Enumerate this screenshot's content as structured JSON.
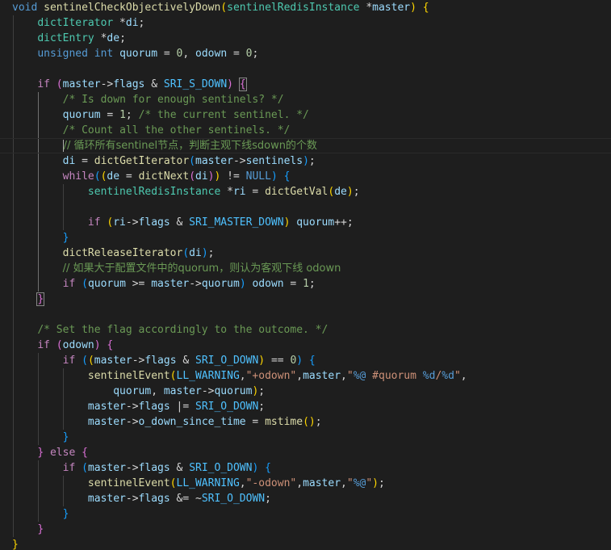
{
  "editor": {
    "theme_colors": {
      "background": "#1e1e1e",
      "default": "#d4d4d4",
      "keyword": "#569cd6",
      "control": "#c586c0",
      "function": "#dcdcaa",
      "type": "#4ec9b0",
      "variable": "#9cdcfe",
      "constant": "#4fc1ff",
      "number": "#b5cea8",
      "string": "#ce9178",
      "comment": "#6a9955",
      "bracket_gold": "#ffd700",
      "bracket_pink": "#da70d6",
      "bracket_blue": "#179fff"
    },
    "lines": [
      [
        [
          "void",
          "keyword"
        ],
        [
          " ",
          ""
        ],
        [
          "sentinelCheckObjectivelyDown",
          "function"
        ],
        [
          "(",
          "bracket_gold"
        ],
        [
          "sentinelRedisInstance",
          "type"
        ],
        [
          " *",
          ""
        ],
        [
          "master",
          "variable"
        ],
        [
          ")",
          "bracket_gold"
        ],
        [
          " ",
          ""
        ],
        [
          "{",
          "bracket_gold"
        ]
      ],
      [
        [
          "    ",
          ""
        ],
        [
          "dictIterator",
          "type"
        ],
        [
          " *",
          ""
        ],
        [
          "di",
          "variable"
        ],
        [
          ";",
          ""
        ]
      ],
      [
        [
          "    ",
          ""
        ],
        [
          "dictEntry",
          "type"
        ],
        [
          " *",
          ""
        ],
        [
          "de",
          "variable"
        ],
        [
          ";",
          ""
        ]
      ],
      [
        [
          "    ",
          ""
        ],
        [
          "unsigned",
          "keyword"
        ],
        [
          " ",
          ""
        ],
        [
          "int",
          "keyword"
        ],
        [
          " ",
          ""
        ],
        [
          "quorum",
          "variable"
        ],
        [
          " = ",
          ""
        ],
        [
          "0",
          "number"
        ],
        [
          ", ",
          ""
        ],
        [
          "odown",
          "variable"
        ],
        [
          " = ",
          ""
        ],
        [
          "0",
          "number"
        ],
        [
          ";",
          ""
        ]
      ],
      [],
      [
        [
          "    ",
          ""
        ],
        [
          "if",
          "control"
        ],
        [
          " ",
          ""
        ],
        [
          "(",
          "bracket_pink"
        ],
        [
          "master",
          "variable"
        ],
        [
          "->",
          ""
        ],
        [
          "flags",
          "variable"
        ],
        [
          " & ",
          ""
        ],
        [
          "SRI_S_DOWN",
          "constant"
        ],
        [
          ")",
          "bracket_pink"
        ],
        [
          " ",
          ""
        ],
        [
          "{",
          "bracket_pink_box"
        ]
      ],
      [
        [
          "        ",
          ""
        ],
        [
          "/* Is down for enough sentinels? */",
          "comment"
        ]
      ],
      [
        [
          "        ",
          ""
        ],
        [
          "quorum",
          "variable"
        ],
        [
          " = ",
          ""
        ],
        [
          "1",
          "number"
        ],
        [
          "; ",
          ""
        ],
        [
          "/* the current sentinel. */",
          "comment"
        ]
      ],
      [
        [
          "        ",
          ""
        ],
        [
          "/* Count all the other sentinels. */",
          "comment"
        ]
      ],
      [
        [
          "        ",
          ""
        ],
        [
          "caret",
          ""
        ],
        [
          "// 循环所有sentinel节点，判断主观下线sdown的个数",
          "comment"
        ]
      ],
      [
        [
          "        ",
          ""
        ],
        [
          "di",
          "variable"
        ],
        [
          " = ",
          ""
        ],
        [
          "dictGetIterator",
          "function"
        ],
        [
          "(",
          "bracket_blue"
        ],
        [
          "master",
          "variable"
        ],
        [
          "->",
          ""
        ],
        [
          "sentinels",
          "variable"
        ],
        [
          ")",
          "bracket_blue"
        ],
        [
          ";",
          ""
        ]
      ],
      [
        [
          "        ",
          ""
        ],
        [
          "while",
          "control"
        ],
        [
          "(",
          "bracket_blue"
        ],
        [
          "(",
          "bracket_gold"
        ],
        [
          "de",
          "variable"
        ],
        [
          " = ",
          ""
        ],
        [
          "dictNext",
          "function"
        ],
        [
          "(",
          "bracket_pink"
        ],
        [
          "di",
          "variable"
        ],
        [
          ")",
          "bracket_pink"
        ],
        [
          ")",
          "bracket_gold"
        ],
        [
          " != ",
          ""
        ],
        [
          "NULL",
          "keyword"
        ],
        [
          ")",
          "bracket_blue"
        ],
        [
          " ",
          ""
        ],
        [
          "{",
          "bracket_blue"
        ]
      ],
      [
        [
          "            ",
          ""
        ],
        [
          "sentinelRedisInstance",
          "type"
        ],
        [
          " *",
          ""
        ],
        [
          "ri",
          "variable"
        ],
        [
          " = ",
          ""
        ],
        [
          "dictGetVal",
          "function"
        ],
        [
          "(",
          "bracket_gold"
        ],
        [
          "de",
          "variable"
        ],
        [
          ")",
          "bracket_gold"
        ],
        [
          ";",
          ""
        ]
      ],
      [],
      [
        [
          "            ",
          ""
        ],
        [
          "if",
          "control"
        ],
        [
          " ",
          ""
        ],
        [
          "(",
          "bracket_gold"
        ],
        [
          "ri",
          "variable"
        ],
        [
          "->",
          ""
        ],
        [
          "flags",
          "variable"
        ],
        [
          " & ",
          ""
        ],
        [
          "SRI_MASTER_DOWN",
          "constant"
        ],
        [
          ")",
          "bracket_gold"
        ],
        [
          " ",
          ""
        ],
        [
          "quorum",
          "variable"
        ],
        [
          "++;",
          ""
        ]
      ],
      [
        [
          "        ",
          ""
        ],
        [
          "}",
          "bracket_blue"
        ]
      ],
      [
        [
          "        ",
          ""
        ],
        [
          "dictReleaseIterator",
          "function"
        ],
        [
          "(",
          "bracket_blue"
        ],
        [
          "di",
          "variable"
        ],
        [
          ")",
          "bracket_blue"
        ],
        [
          ";",
          ""
        ]
      ],
      [
        [
          "        ",
          ""
        ],
        [
          "// 如果大于配置文件中的quorum，则认为客观下线 odown",
          "comment"
        ]
      ],
      [
        [
          "        ",
          ""
        ],
        [
          "if",
          "control"
        ],
        [
          " ",
          ""
        ],
        [
          "(",
          "bracket_blue"
        ],
        [
          "quorum",
          "variable"
        ],
        [
          " >= ",
          ""
        ],
        [
          "master",
          "variable"
        ],
        [
          "->",
          ""
        ],
        [
          "quorum",
          "variable"
        ],
        [
          ")",
          "bracket_blue"
        ],
        [
          " ",
          ""
        ],
        [
          "odown",
          "variable"
        ],
        [
          " = ",
          ""
        ],
        [
          "1",
          "number"
        ],
        [
          ";",
          ""
        ]
      ],
      [
        [
          "    ",
          ""
        ],
        [
          "}",
          "bracket_pink_box"
        ]
      ],
      [],
      [
        [
          "    ",
          ""
        ],
        [
          "/* Set the flag accordingly to the outcome. */",
          "comment"
        ]
      ],
      [
        [
          "    ",
          ""
        ],
        [
          "if",
          "control"
        ],
        [
          " ",
          ""
        ],
        [
          "(",
          "bracket_pink"
        ],
        [
          "odown",
          "variable"
        ],
        [
          ")",
          "bracket_pink"
        ],
        [
          " ",
          ""
        ],
        [
          "{",
          "bracket_pink"
        ]
      ],
      [
        [
          "        ",
          ""
        ],
        [
          "if",
          "control"
        ],
        [
          " ",
          ""
        ],
        [
          "(",
          "bracket_blue"
        ],
        [
          "(",
          "bracket_gold"
        ],
        [
          "master",
          "variable"
        ],
        [
          "->",
          ""
        ],
        [
          "flags",
          "variable"
        ],
        [
          " & ",
          ""
        ],
        [
          "SRI_O_DOWN",
          "constant"
        ],
        [
          ")",
          "bracket_gold"
        ],
        [
          " == ",
          ""
        ],
        [
          "0",
          "number"
        ],
        [
          ")",
          "bracket_blue"
        ],
        [
          " ",
          ""
        ],
        [
          "{",
          "bracket_blue"
        ]
      ],
      [
        [
          "            ",
          ""
        ],
        [
          "sentinelEvent",
          "function"
        ],
        [
          "(",
          "bracket_gold"
        ],
        [
          "LL_WARNING",
          "constant"
        ],
        [
          ",",
          ""
        ],
        [
          "\"+odown\"",
          "string"
        ],
        [
          ",",
          ""
        ],
        [
          "master",
          "variable"
        ],
        [
          ",",
          ""
        ],
        [
          "\"",
          "string"
        ],
        [
          "%@",
          "keyword"
        ],
        [
          " #quorum ",
          "string"
        ],
        [
          "%d",
          "keyword"
        ],
        [
          "/",
          "string"
        ],
        [
          "%d",
          "keyword"
        ],
        [
          "\"",
          "string"
        ],
        [
          ",",
          ""
        ]
      ],
      [
        [
          "                ",
          ""
        ],
        [
          "quorum",
          "variable"
        ],
        [
          ", ",
          ""
        ],
        [
          "master",
          "variable"
        ],
        [
          "->",
          ""
        ],
        [
          "quorum",
          "variable"
        ],
        [
          ")",
          "bracket_gold"
        ],
        [
          ";",
          ""
        ]
      ],
      [
        [
          "            ",
          ""
        ],
        [
          "master",
          "variable"
        ],
        [
          "->",
          ""
        ],
        [
          "flags",
          "variable"
        ],
        [
          " |= ",
          ""
        ],
        [
          "SRI_O_DOWN",
          "constant"
        ],
        [
          ";",
          ""
        ]
      ],
      [
        [
          "            ",
          ""
        ],
        [
          "master",
          "variable"
        ],
        [
          "->",
          ""
        ],
        [
          "o_down_since_time",
          "variable"
        ],
        [
          " = ",
          ""
        ],
        [
          "mstime",
          "function"
        ],
        [
          "(",
          "bracket_gold"
        ],
        [
          ")",
          "bracket_gold"
        ],
        [
          ";",
          ""
        ]
      ],
      [
        [
          "        ",
          ""
        ],
        [
          "}",
          "bracket_blue"
        ]
      ],
      [
        [
          "    ",
          ""
        ],
        [
          "}",
          "bracket_pink"
        ],
        [
          " ",
          ""
        ],
        [
          "else",
          "control"
        ],
        [
          " ",
          ""
        ],
        [
          "{",
          "bracket_pink"
        ]
      ],
      [
        [
          "        ",
          ""
        ],
        [
          "if",
          "control"
        ],
        [
          " ",
          ""
        ],
        [
          "(",
          "bracket_blue"
        ],
        [
          "master",
          "variable"
        ],
        [
          "->",
          ""
        ],
        [
          "flags",
          "variable"
        ],
        [
          " & ",
          ""
        ],
        [
          "SRI_O_DOWN",
          "constant"
        ],
        [
          ")",
          "bracket_blue"
        ],
        [
          " ",
          ""
        ],
        [
          "{",
          "bracket_blue"
        ]
      ],
      [
        [
          "            ",
          ""
        ],
        [
          "sentinelEvent",
          "function"
        ],
        [
          "(",
          "bracket_gold"
        ],
        [
          "LL_WARNING",
          "constant"
        ],
        [
          ",",
          ""
        ],
        [
          "\"-odown\"",
          "string"
        ],
        [
          ",",
          ""
        ],
        [
          "master",
          "variable"
        ],
        [
          ",",
          ""
        ],
        [
          "\"",
          "string"
        ],
        [
          "%@",
          "keyword"
        ],
        [
          "\"",
          "string"
        ],
        [
          ")",
          "bracket_gold"
        ],
        [
          ";",
          ""
        ]
      ],
      [
        [
          "            ",
          ""
        ],
        [
          "master",
          "variable"
        ],
        [
          "->",
          ""
        ],
        [
          "flags",
          "variable"
        ],
        [
          " &= ~",
          ""
        ],
        [
          "SRI_O_DOWN",
          "constant"
        ],
        [
          ";",
          ""
        ]
      ],
      [
        [
          "        ",
          ""
        ],
        [
          "}",
          "bracket_blue"
        ]
      ],
      [
        [
          "    ",
          ""
        ],
        [
          "}",
          "bracket_pink"
        ]
      ],
      [
        [
          "}",
          "bracket_gold"
        ]
      ]
    ]
  }
}
